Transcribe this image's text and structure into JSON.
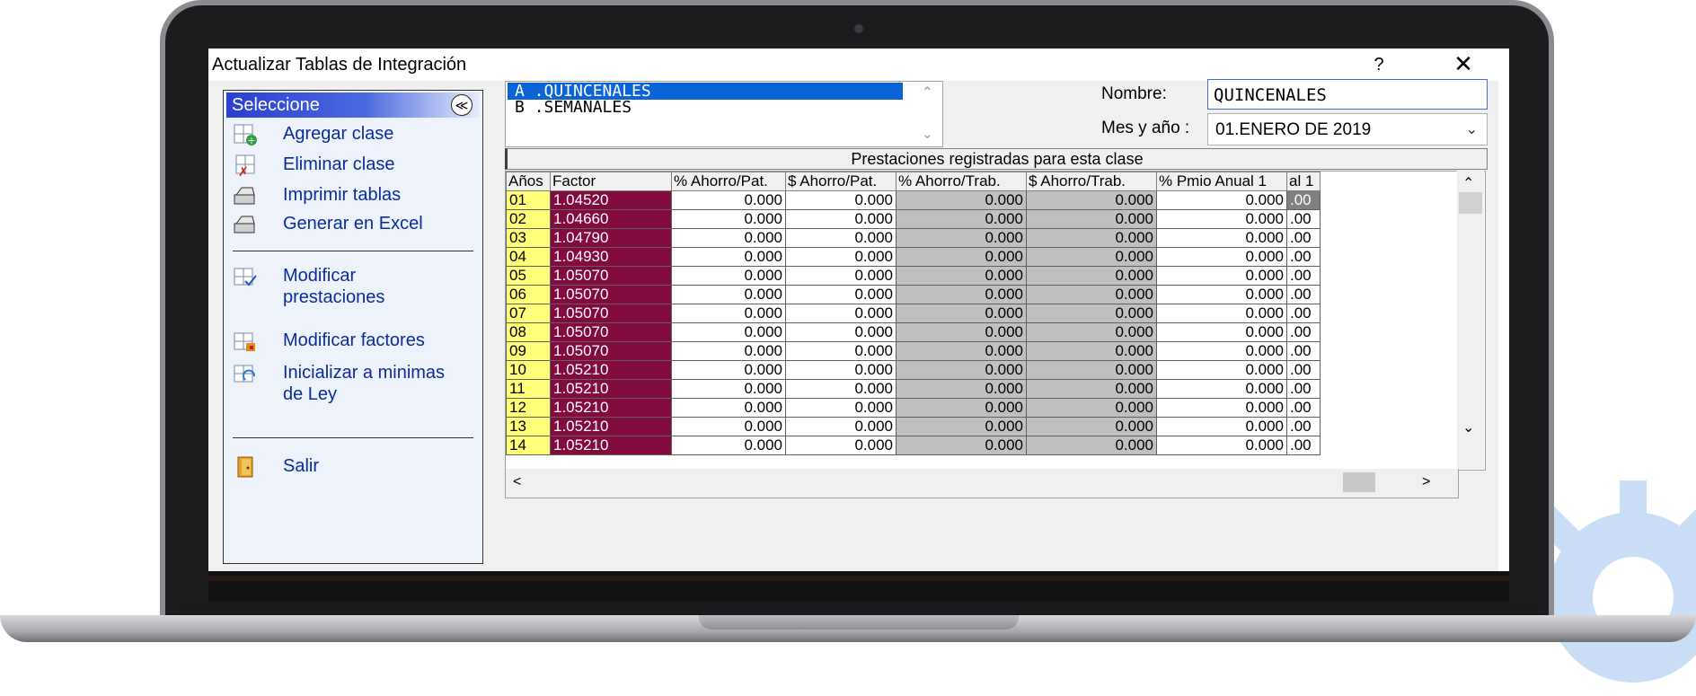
{
  "window": {
    "title": "Actualizar Tablas de Integración",
    "help_label": "?",
    "close_label": "✕"
  },
  "left_panel": {
    "header": "Seleccione",
    "collapse_label": "≪",
    "items": [
      {
        "label": "Agregar clase",
        "icon": "add-table-icon"
      },
      {
        "label": "Eliminar clase",
        "icon": "delete-table-icon"
      },
      {
        "label": "Imprimir tablas",
        "icon": "printer-icon"
      },
      {
        "label": "Generar en Excel",
        "icon": "printer-icon"
      },
      {
        "label": "Modificar prestaciones",
        "icon": "edit-table-icon"
      },
      {
        "label": "Modificar factores",
        "icon": "factor-table-icon"
      },
      {
        "label": "Inicializar a minimas de Ley",
        "icon": "reset-table-icon"
      },
      {
        "label": "Salir",
        "icon": "exit-door-icon"
      }
    ]
  },
  "class_list": {
    "items": [
      "A .QUINCENALES",
      "B .SEMANALES"
    ],
    "selected": "A .QUINCENALES"
  },
  "form": {
    "nombre_label": "Nombre:",
    "nombre_value": "QUINCENALES",
    "mes_label": "Mes y año :",
    "mes_value": "01.ENERO DE 2019"
  },
  "grid": {
    "caption": "Prestaciones registradas para esta clase",
    "columns": [
      "Años",
      "Factor",
      "% Ahorro/Pat.",
      "$ Ahorro/Pat.",
      "% Ahorro/Trab.",
      "$ Ahorro/Trab.",
      "% Pmio Anual 1",
      "al 1"
    ],
    "rows": [
      {
        "anio": "01",
        "factor": "1.04520",
        "pap": "0.000",
        "sap": "0.000",
        "pat": "0.000",
        "sat": "0.000",
        "pma": "0.000",
        "last": ".00"
      },
      {
        "anio": "02",
        "factor": "1.04660",
        "pap": "0.000",
        "sap": "0.000",
        "pat": "0.000",
        "sat": "0.000",
        "pma": "0.000",
        "last": ".00"
      },
      {
        "anio": "03",
        "factor": "1.04790",
        "pap": "0.000",
        "sap": "0.000",
        "pat": "0.000",
        "sat": "0.000",
        "pma": "0.000",
        "last": ".00"
      },
      {
        "anio": "04",
        "factor": "1.04930",
        "pap": "0.000",
        "sap": "0.000",
        "pat": "0.000",
        "sat": "0.000",
        "pma": "0.000",
        "last": ".00"
      },
      {
        "anio": "05",
        "factor": "1.05070",
        "pap": "0.000",
        "sap": "0.000",
        "pat": "0.000",
        "sat": "0.000",
        "pma": "0.000",
        "last": ".00"
      },
      {
        "anio": "06",
        "factor": "1.05070",
        "pap": "0.000",
        "sap": "0.000",
        "pat": "0.000",
        "sat": "0.000",
        "pma": "0.000",
        "last": ".00"
      },
      {
        "anio": "07",
        "factor": "1.05070",
        "pap": "0.000",
        "sap": "0.000",
        "pat": "0.000",
        "sat": "0.000",
        "pma": "0.000",
        "last": ".00"
      },
      {
        "anio": "08",
        "factor": "1.05070",
        "pap": "0.000",
        "sap": "0.000",
        "pat": "0.000",
        "sat": "0.000",
        "pma": "0.000",
        "last": ".00"
      },
      {
        "anio": "09",
        "factor": "1.05070",
        "pap": "0.000",
        "sap": "0.000",
        "pat": "0.000",
        "sat": "0.000",
        "pma": "0.000",
        "last": ".00"
      },
      {
        "anio": "10",
        "factor": "1.05210",
        "pap": "0.000",
        "sap": "0.000",
        "pat": "0.000",
        "sat": "0.000",
        "pma": "0.000",
        "last": ".00"
      },
      {
        "anio": "11",
        "factor": "1.05210",
        "pap": "0.000",
        "sap": "0.000",
        "pat": "0.000",
        "sat": "0.000",
        "pma": "0.000",
        "last": ".00"
      },
      {
        "anio": "12",
        "factor": "1.05210",
        "pap": "0.000",
        "sap": "0.000",
        "pat": "0.000",
        "sat": "0.000",
        "pma": "0.000",
        "last": ".00"
      },
      {
        "anio": "13",
        "factor": "1.05210",
        "pap": "0.000",
        "sap": "0.000",
        "pat": "0.000",
        "sat": "0.000",
        "pma": "0.000",
        "last": ".00"
      },
      {
        "anio": "14",
        "factor": "1.05210",
        "pap": "0.000",
        "sap": "0.000",
        "pat": "0.000",
        "sat": "0.000",
        "pma": "0.000",
        "last": ".00"
      }
    ]
  },
  "colors": {
    "factor_bg": "#820a3e",
    "anio_bg": "#ffff7a",
    "trab_bg": "#c0c0c0",
    "selection": "#0a64d8",
    "menu_text": "#0a2c9a"
  }
}
